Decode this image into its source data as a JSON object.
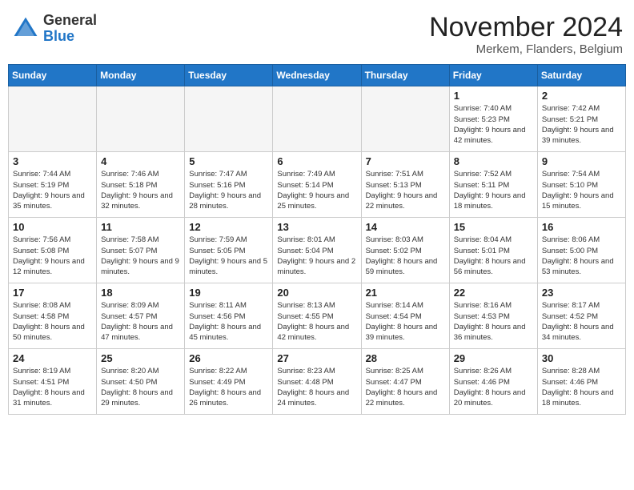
{
  "header": {
    "logo_general": "General",
    "logo_blue": "Blue",
    "month_title": "November 2024",
    "location": "Merkem, Flanders, Belgium"
  },
  "days_of_week": [
    "Sunday",
    "Monday",
    "Tuesday",
    "Wednesday",
    "Thursday",
    "Friday",
    "Saturday"
  ],
  "weeks": [
    [
      {
        "day": "",
        "info": ""
      },
      {
        "day": "",
        "info": ""
      },
      {
        "day": "",
        "info": ""
      },
      {
        "day": "",
        "info": ""
      },
      {
        "day": "",
        "info": ""
      },
      {
        "day": "1",
        "info": "Sunrise: 7:40 AM\nSunset: 5:23 PM\nDaylight: 9 hours and 42 minutes."
      },
      {
        "day": "2",
        "info": "Sunrise: 7:42 AM\nSunset: 5:21 PM\nDaylight: 9 hours and 39 minutes."
      }
    ],
    [
      {
        "day": "3",
        "info": "Sunrise: 7:44 AM\nSunset: 5:19 PM\nDaylight: 9 hours and 35 minutes."
      },
      {
        "day": "4",
        "info": "Sunrise: 7:46 AM\nSunset: 5:18 PM\nDaylight: 9 hours and 32 minutes."
      },
      {
        "day": "5",
        "info": "Sunrise: 7:47 AM\nSunset: 5:16 PM\nDaylight: 9 hours and 28 minutes."
      },
      {
        "day": "6",
        "info": "Sunrise: 7:49 AM\nSunset: 5:14 PM\nDaylight: 9 hours and 25 minutes."
      },
      {
        "day": "7",
        "info": "Sunrise: 7:51 AM\nSunset: 5:13 PM\nDaylight: 9 hours and 22 minutes."
      },
      {
        "day": "8",
        "info": "Sunrise: 7:52 AM\nSunset: 5:11 PM\nDaylight: 9 hours and 18 minutes."
      },
      {
        "day": "9",
        "info": "Sunrise: 7:54 AM\nSunset: 5:10 PM\nDaylight: 9 hours and 15 minutes."
      }
    ],
    [
      {
        "day": "10",
        "info": "Sunrise: 7:56 AM\nSunset: 5:08 PM\nDaylight: 9 hours and 12 minutes."
      },
      {
        "day": "11",
        "info": "Sunrise: 7:58 AM\nSunset: 5:07 PM\nDaylight: 9 hours and 9 minutes."
      },
      {
        "day": "12",
        "info": "Sunrise: 7:59 AM\nSunset: 5:05 PM\nDaylight: 9 hours and 5 minutes."
      },
      {
        "day": "13",
        "info": "Sunrise: 8:01 AM\nSunset: 5:04 PM\nDaylight: 9 hours and 2 minutes."
      },
      {
        "day": "14",
        "info": "Sunrise: 8:03 AM\nSunset: 5:02 PM\nDaylight: 8 hours and 59 minutes."
      },
      {
        "day": "15",
        "info": "Sunrise: 8:04 AM\nSunset: 5:01 PM\nDaylight: 8 hours and 56 minutes."
      },
      {
        "day": "16",
        "info": "Sunrise: 8:06 AM\nSunset: 5:00 PM\nDaylight: 8 hours and 53 minutes."
      }
    ],
    [
      {
        "day": "17",
        "info": "Sunrise: 8:08 AM\nSunset: 4:58 PM\nDaylight: 8 hours and 50 minutes."
      },
      {
        "day": "18",
        "info": "Sunrise: 8:09 AM\nSunset: 4:57 PM\nDaylight: 8 hours and 47 minutes."
      },
      {
        "day": "19",
        "info": "Sunrise: 8:11 AM\nSunset: 4:56 PM\nDaylight: 8 hours and 45 minutes."
      },
      {
        "day": "20",
        "info": "Sunrise: 8:13 AM\nSunset: 4:55 PM\nDaylight: 8 hours and 42 minutes."
      },
      {
        "day": "21",
        "info": "Sunrise: 8:14 AM\nSunset: 4:54 PM\nDaylight: 8 hours and 39 minutes."
      },
      {
        "day": "22",
        "info": "Sunrise: 8:16 AM\nSunset: 4:53 PM\nDaylight: 8 hours and 36 minutes."
      },
      {
        "day": "23",
        "info": "Sunrise: 8:17 AM\nSunset: 4:52 PM\nDaylight: 8 hours and 34 minutes."
      }
    ],
    [
      {
        "day": "24",
        "info": "Sunrise: 8:19 AM\nSunset: 4:51 PM\nDaylight: 8 hours and 31 minutes."
      },
      {
        "day": "25",
        "info": "Sunrise: 8:20 AM\nSunset: 4:50 PM\nDaylight: 8 hours and 29 minutes."
      },
      {
        "day": "26",
        "info": "Sunrise: 8:22 AM\nSunset: 4:49 PM\nDaylight: 8 hours and 26 minutes."
      },
      {
        "day": "27",
        "info": "Sunrise: 8:23 AM\nSunset: 4:48 PM\nDaylight: 8 hours and 24 minutes."
      },
      {
        "day": "28",
        "info": "Sunrise: 8:25 AM\nSunset: 4:47 PM\nDaylight: 8 hours and 22 minutes."
      },
      {
        "day": "29",
        "info": "Sunrise: 8:26 AM\nSunset: 4:46 PM\nDaylight: 8 hours and 20 minutes."
      },
      {
        "day": "30",
        "info": "Sunrise: 8:28 AM\nSunset: 4:46 PM\nDaylight: 8 hours and 18 minutes."
      }
    ]
  ]
}
